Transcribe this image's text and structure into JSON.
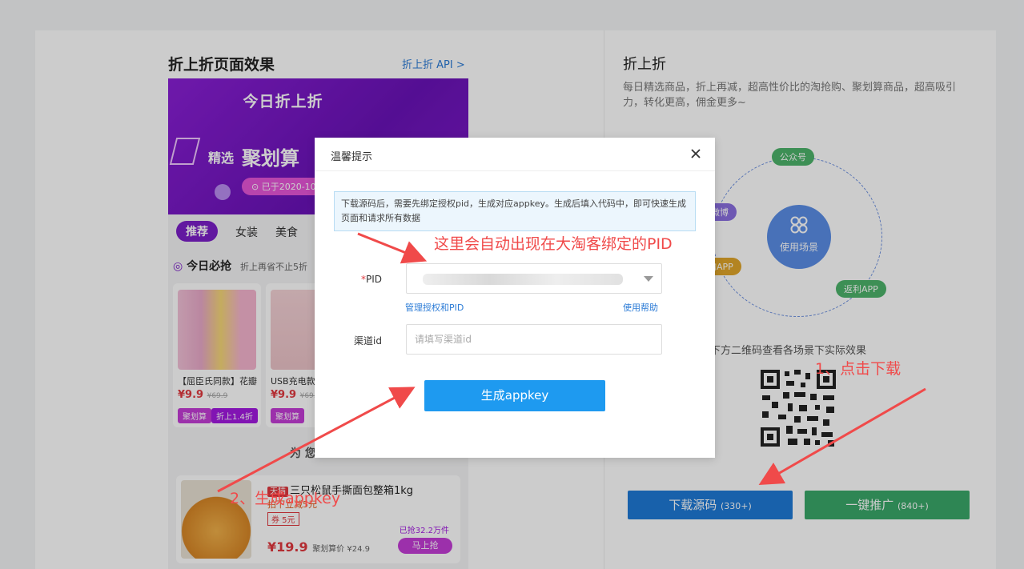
{
  "preview": {
    "title": "折上折页面效果",
    "api_link": "折上折 API >",
    "banner": {
      "title": "今日折上折",
      "pick": "精选",
      "brand": "聚划算",
      "pill": "⊙ 已于2020-10"
    },
    "tabs": [
      "推荐",
      "女装",
      "美食"
    ],
    "must_title": "今日必抢",
    "must_sub": "折上再省不止5折",
    "goods": [
      {
        "name": "【屈臣氏同款】花瓣",
        "price": "¥9.9",
        "orig": "¥69.9",
        "tag1": "聚划算",
        "tag2": "折上1.4折"
      },
      {
        "name": "USB充电款",
        "price": "¥9.9",
        "orig": "¥69.",
        "tag1": "聚划算",
        "tag2": ""
      }
    ],
    "for_you": "为 您",
    "big_item": {
      "store_tag": "天猫",
      "title": "三只松鼠手撕面包整箱1kg",
      "sub": "拍下立减5元",
      "coupon": "券 5元",
      "sold": "已抢32.2万件",
      "price": "¥19.9",
      "price_note": "聚划算价 ¥24.9",
      "buy": "马上抢"
    }
  },
  "right": {
    "title": "折上折",
    "desc": "每日精选商品，折上再减，超高性价比的淘抢购、聚划算商品，超高吸引力，转化更高，佣金更多~",
    "scene_center": "使用场景",
    "chips": {
      "gzh": "公众号",
      "weibo": "微博",
      "gouapp": "购APP",
      "fanli": "返利APP"
    },
    "qr_label": "描下方二维码查看各场景下实际效果",
    "download_label": "下载源码",
    "download_count": "(330+)",
    "promote_label": "一键推广",
    "promote_count": "(840+)"
  },
  "modal": {
    "title": "温馨提示",
    "notice": "下载源码后，需要先绑定授权pid，生成对应appkey。生成后填入代码中，即可快速生成页面和请求所有数据",
    "pid_required": "*",
    "pid_label": "PID",
    "manage_link": "管理授权和PID",
    "help_link": "使用帮助",
    "channel_label": "渠道id",
    "channel_placeholder": "请填写渠道id",
    "generate_label": "生成appkey"
  },
  "annotations": {
    "pid_note": "这里会自动出现在大淘客绑定的PID",
    "step1": "1、点击下载",
    "step2": "2、生成appkey"
  },
  "colors": {
    "primary": "#1e9af0",
    "download": "#1e7ad6",
    "promote": "#3aa86a",
    "annotation": "#f04a4a",
    "banner": "#7b1fc9"
  }
}
